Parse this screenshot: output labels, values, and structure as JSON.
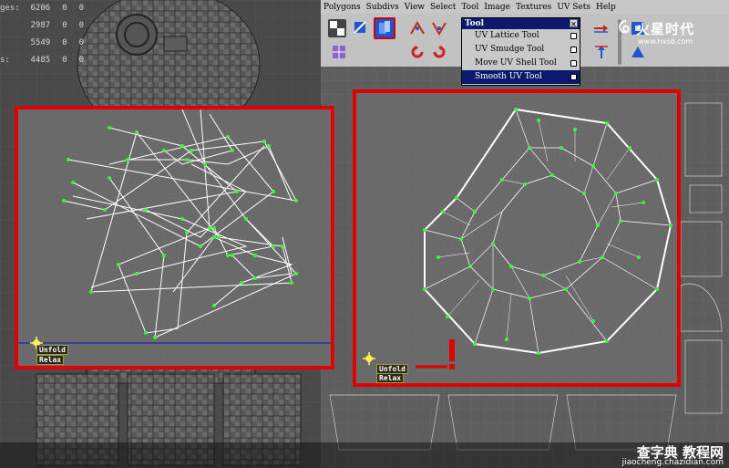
{
  "poly_stats": [
    {
      "label": "ges:",
      "value": "6206",
      "extra": "0",
      "extra2": "0"
    },
    {
      "label": "",
      "value": "2987",
      "extra": "0",
      "extra2": "0"
    },
    {
      "label": "",
      "value": "5549",
      "extra": "0",
      "extra2": "0"
    },
    {
      "label": "s:",
      "value": "4485",
      "extra": "0",
      "extra2": "0"
    }
  ],
  "menubar": {
    "items": [
      "Polygons",
      "Subdivs",
      "View",
      "Select",
      "Tool",
      "Image",
      "Textures",
      "UV Sets",
      "Help"
    ]
  },
  "tool_menu": {
    "title": "Tool",
    "close": "×",
    "items": [
      {
        "label": "UV Lattice Tool",
        "selected": false
      },
      {
        "label": "UV Smudge Tool",
        "selected": false
      },
      {
        "label": "Move UV Shell Tool",
        "selected": false
      },
      {
        "label": "Smooth UV Tool",
        "selected": true
      }
    ]
  },
  "logo": {
    "main": "火星时代",
    "url": "www.hxsd.com"
  },
  "left_panel": {
    "unfold": "Unfold",
    "relax": "Relax"
  },
  "right_panel": {
    "unfold": "Unfold",
    "relax": "Relax"
  },
  "footer": {
    "brand": "查字典 教程网",
    "url": "jiaocheng.chazidian.com"
  },
  "colors": {
    "frame": "#e00000",
    "uv_point": "#33ff33",
    "uv_line": "#ffffff",
    "menu_selected": "#0b1a6d"
  },
  "icons": [
    "checker-icon",
    "uv-toggle-icon",
    "selected-tool-icon",
    "flip-icon",
    "rotate-ccw-icon",
    "rotate-cw-icon",
    "arrow-right-icon",
    "arrow-up-icon"
  ]
}
